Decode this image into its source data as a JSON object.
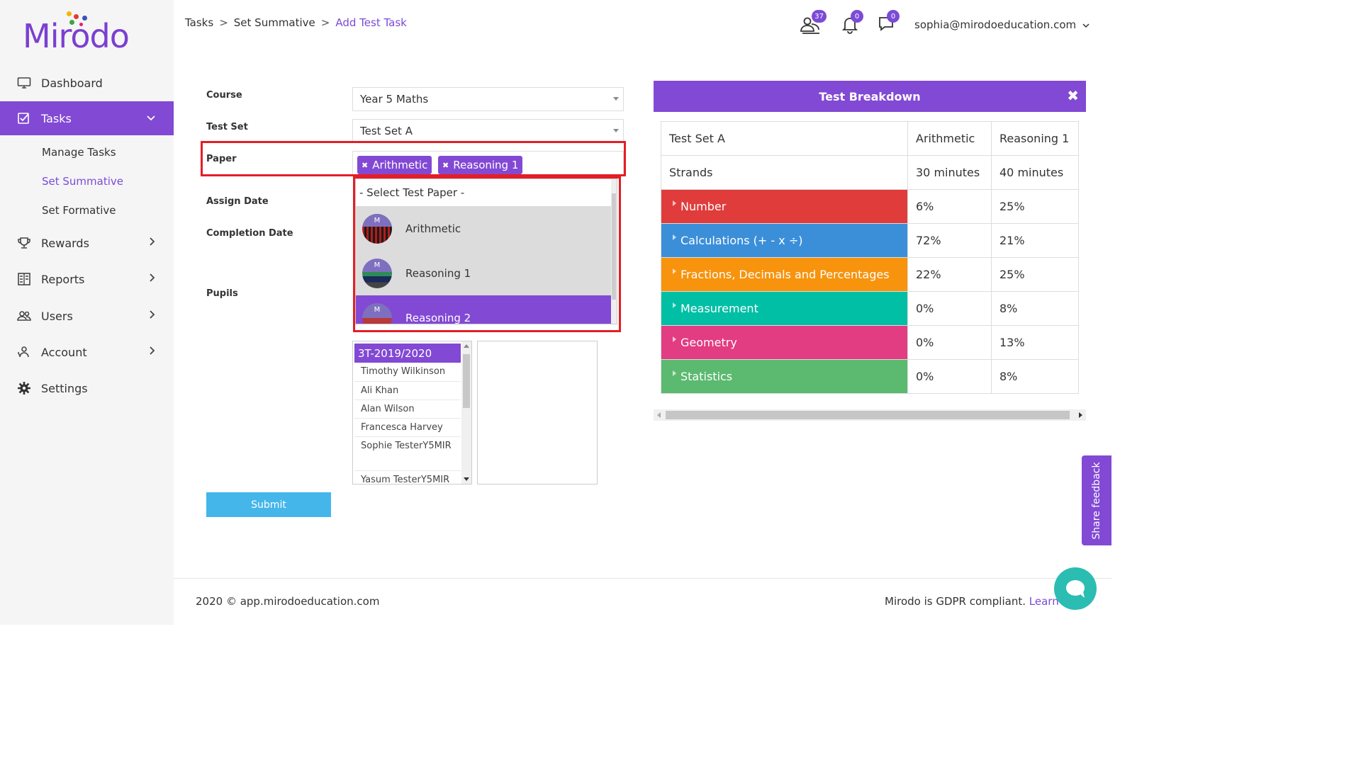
{
  "brand": {
    "logo_text": "Mirodo",
    "accent": "#8249d4",
    "dot_colors": [
      "#f4b400",
      "#e53935",
      "#3f51b5",
      "#43a047"
    ]
  },
  "sidebar": {
    "items": [
      {
        "label": "Dashboard",
        "icon": "monitor-icon"
      },
      {
        "label": "Tasks",
        "icon": "tasks-icon",
        "active": true
      },
      {
        "label": "Rewards",
        "icon": "trophy-icon"
      },
      {
        "label": "Reports",
        "icon": "reports-icon"
      },
      {
        "label": "Users",
        "icon": "users-icon"
      },
      {
        "label": "Account",
        "icon": "account-icon"
      },
      {
        "label": "Settings",
        "icon": "gear-icon"
      }
    ],
    "sub_items": [
      {
        "label": "Manage Tasks"
      },
      {
        "label": "Set Summative",
        "current": true
      },
      {
        "label": "Set Formative"
      }
    ]
  },
  "header": {
    "breadcrumb": [
      "Tasks",
      "Set Summative",
      "Add Test Task"
    ],
    "breadcrumb_sep": ">",
    "users_badge": "37",
    "notifications_badge": "0",
    "messages_badge": "0",
    "user_email": "sophia@mirodoeducation.com"
  },
  "form": {
    "course_label": "Course",
    "course_value": "Year 5 Maths",
    "testset_label": "Test Set",
    "testset_value": "Test Set A",
    "paper_label": "Paper",
    "paper_chips": [
      "Arithmetic",
      "Reasoning 1"
    ],
    "assign_date_label": "Assign Date",
    "completion_date_label": "Completion Date",
    "pupils_label": "Pupils",
    "dropdown": {
      "placeholder": "- Select Test Paper -",
      "options": [
        {
          "label": "Arithmetic",
          "avatar_letter": "M",
          "highlighted": false
        },
        {
          "label": "Reasoning 1",
          "avatar_letter": "M",
          "highlighted": false
        },
        {
          "label": "Reasoning 2",
          "avatar_letter": "M",
          "highlighted": true
        }
      ]
    },
    "pupils": {
      "group": "3T-2019/2020",
      "names": [
        "Timothy Wilkinson",
        "Ali Khan",
        "Alan Wilson",
        "Francesca Harvey",
        "Sophie TesterY5MIR",
        "Yasum TesterY5MIR"
      ]
    },
    "submit_label": "Submit"
  },
  "breakdown": {
    "title": "Test Breakdown",
    "close_icon": "close-icon",
    "header_row": [
      "Test Set A",
      "Arithmetic",
      "Reasoning 1"
    ],
    "strands_row": [
      "Strands",
      "30 minutes",
      "40 minutes"
    ],
    "strands": [
      {
        "name": "Number",
        "color": "#e03c3c",
        "values": [
          "6%",
          "25%"
        ]
      },
      {
        "name": "Calculations (+ - x ÷)",
        "color": "#3b8fd9",
        "values": [
          "72%",
          "21%"
        ]
      },
      {
        "name": "Fractions, Decimals and Percentages",
        "color": "#f7930d",
        "values": [
          "22%",
          "25%"
        ]
      },
      {
        "name": "Measurement",
        "color": "#00bfa5",
        "values": [
          "0%",
          "8%"
        ]
      },
      {
        "name": "Geometry",
        "color": "#e23c82",
        "values": [
          "0%",
          "13%"
        ]
      },
      {
        "name": "Statistics",
        "color": "#5bba6f",
        "values": [
          "0%",
          "8%"
        ]
      }
    ]
  },
  "footer": {
    "copyright": "2020 © app.mirodoeducation.com",
    "gdpr_text": "Mirodo is GDPR compliant.",
    "gdpr_link": "Learn",
    "feedback_label": "Share feedback"
  }
}
